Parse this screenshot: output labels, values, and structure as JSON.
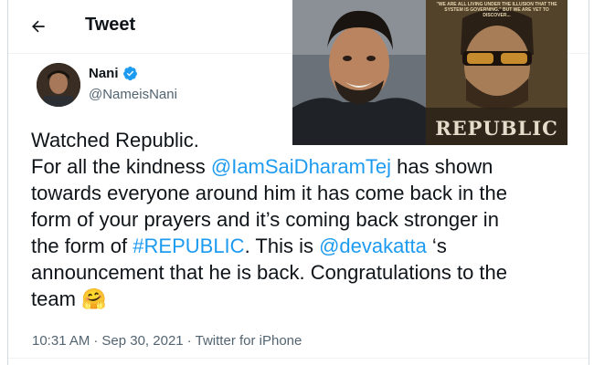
{
  "header": {
    "title": "Tweet",
    "back_icon": "arrow-left-icon"
  },
  "author": {
    "name": "Nani",
    "handle": "@NameisNani",
    "verified": true,
    "verified_color": "#1d9bf0"
  },
  "tweet": {
    "line1": "Watched Republic.",
    "line2_a": "For all the kindness ",
    "mention1": "@IamSaiDharamTej",
    "line2_b": " has shown",
    "line3": "towards everyone around him it has come back in the",
    "line4": "form of your prayers and it’s coming back stronger in",
    "line5_a": "the form of ",
    "hashtag": "#REPUBLIC",
    "line5_b": ". This is ",
    "mention2": "@devakatta",
    "line5_c": " ‘s",
    "line6": "announcement that he is back. Congratulations to the",
    "line7": "team",
    "emoji": "🤗",
    "emoji_name": "hugging-face-emoji"
  },
  "meta": {
    "time": "10:31 AM",
    "sep1": "·",
    "date": "Sep 30, 2021",
    "sep2": "·",
    "source": "Twitter for iPhone"
  },
  "poster": {
    "tagline": "\"WE ARE ALL LIVING UNDER THE ILLUSION THAT THE SYSTEM IS GOVERNING.\" BUT WE ARE YET TO DISCOVER...",
    "title": "REPUBLIC"
  },
  "colors": {
    "link": "#1d9bf0",
    "text": "#0f1419",
    "muted": "#536471"
  }
}
